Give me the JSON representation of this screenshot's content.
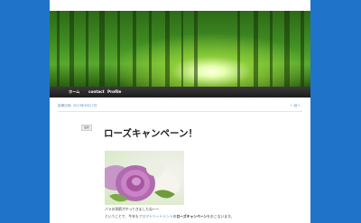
{
  "nav": {
    "items": [
      {
        "label": "ホーム"
      },
      {
        "label": "contact"
      },
      {
        "label": "Profile"
      }
    ]
  },
  "post_meta": {
    "left": "投稿日時: 2013年6月17日",
    "right": "← 前へ"
  },
  "post": {
    "category": "最新",
    "title": "ローズキャンペーン！",
    "line1": "バラの季節がやってきましたね〜〜",
    "line2_prefix": "ということで、今年も",
    "line2_link": "アロマトリートメント",
    "line2_mid": "の",
    "line2_strong": "ローズキャンペーン",
    "line2_suffix": "をおこないます。"
  },
  "colors": {
    "background": "#1f73c9",
    "navbar": "#222222",
    "link": "#3f7fc4"
  }
}
